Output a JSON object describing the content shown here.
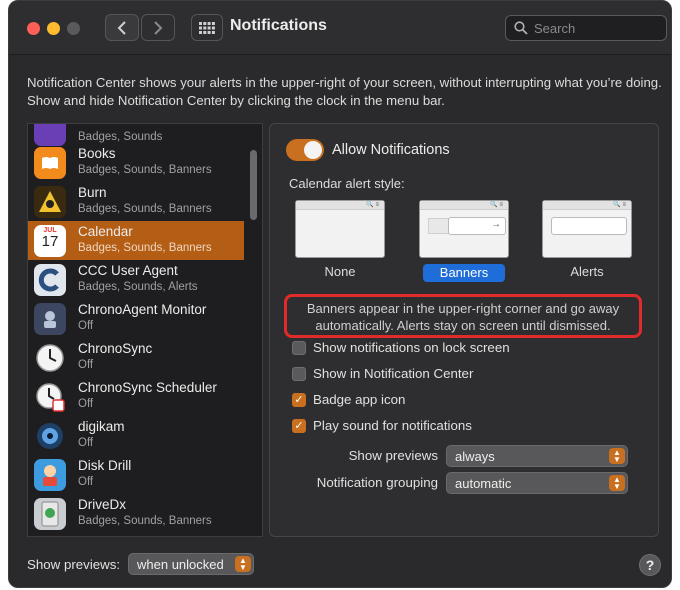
{
  "window": {
    "title": "Notifications",
    "search_placeholder": "Search"
  },
  "description": "Notification Center shows your alerts in the upper-right of your screen, without interrupting what you’re doing. Show and hide Notification Center by clicking the clock in the menu bar.",
  "apps": [
    {
      "name": "",
      "sub": "Badges, Sounds",
      "icon": "purple-app-icon"
    },
    {
      "name": "Books",
      "sub": "Badges, Sounds, Banners",
      "icon": "books-icon"
    },
    {
      "name": "Burn",
      "sub": "Badges, Sounds, Banners",
      "icon": "burn-icon"
    },
    {
      "name": "Calendar",
      "sub": "Badges, Sounds, Banners",
      "icon": "calendar-icon",
      "selected": true,
      "cal_month": "JUL",
      "cal_day": "17"
    },
    {
      "name": "CCC User Agent",
      "sub": "Badges, Sounds, Alerts",
      "icon": "ccc-icon"
    },
    {
      "name": "ChronoAgent Monitor",
      "sub": "Off",
      "icon": "chronoagent-icon"
    },
    {
      "name": "ChronoSync",
      "sub": "Off",
      "icon": "clock-icon"
    },
    {
      "name": "ChronoSync Scheduler",
      "sub": "Off",
      "icon": "clock-calendar-icon"
    },
    {
      "name": "digikam",
      "sub": "Off",
      "icon": "digikam-icon"
    },
    {
      "name": "Disk Drill",
      "sub": "Off",
      "icon": "disk-drill-icon"
    },
    {
      "name": "DriveDx",
      "sub": "Badges, Sounds, Banners",
      "icon": "drivedx-icon"
    }
  ],
  "panel": {
    "allow_label": "Allow Notifications",
    "allow_on": true,
    "alert_style_label": "Calendar alert style:",
    "styles": [
      {
        "label": "None",
        "active": false
      },
      {
        "label": "Banners",
        "active": true
      },
      {
        "label": "Alerts",
        "active": false
      }
    ],
    "callout_text": "Banners appear in the upper-right corner and go away automatically. Alerts stay on screen until dismissed.",
    "checkboxes": [
      {
        "label": "Show notifications on lock screen",
        "checked": false
      },
      {
        "label": "Show in Notification Center",
        "checked": false
      },
      {
        "label": "Badge app icon",
        "checked": true
      },
      {
        "label": "Play sound for notifications",
        "checked": true
      }
    ],
    "show_previews_label": "Show previews",
    "show_previews_value": "always",
    "grouping_label": "Notification grouping",
    "grouping_value": "automatic"
  },
  "bottom": {
    "show_previews_label": "Show previews:",
    "show_previews_value": "when unlocked"
  },
  "help_label": "?",
  "colors": {
    "accent": "#c87020",
    "selected_row": "#b45e15",
    "callout_border": "#e12b2b",
    "banner_select": "#1f6dd8"
  }
}
